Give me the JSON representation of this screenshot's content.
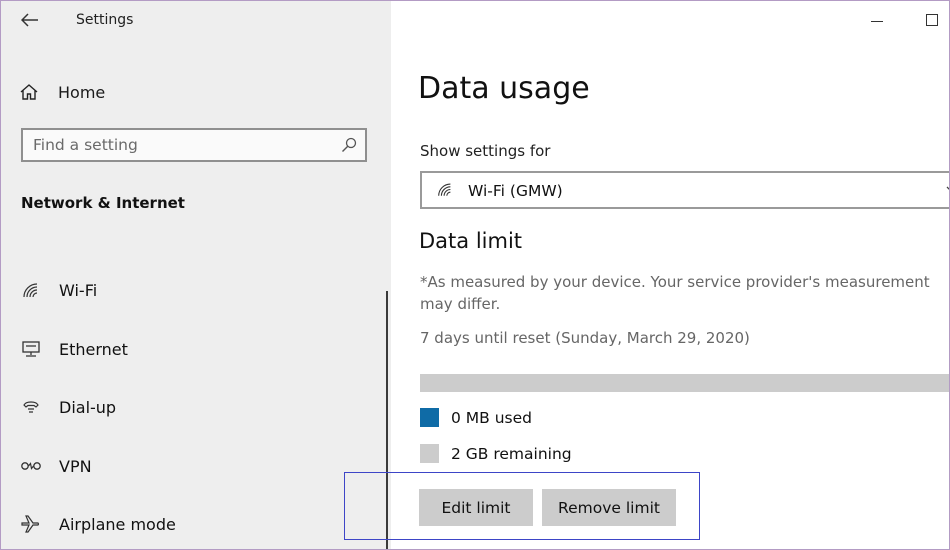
{
  "window": {
    "title": "Settings",
    "controls": {
      "minimize": "minimize",
      "maximize": "maximize"
    }
  },
  "sidebar": {
    "home_label": "Home",
    "search": {
      "placeholder": "Find a setting",
      "value": ""
    },
    "section_title": "Network & Internet",
    "items": [
      {
        "label": "Wi-Fi",
        "icon": "wifi-icon"
      },
      {
        "label": "Ethernet",
        "icon": "ethernet-icon"
      },
      {
        "label": "Dial-up",
        "icon": "dialup-icon"
      },
      {
        "label": "VPN",
        "icon": "vpn-icon"
      },
      {
        "label": "Airplane mode",
        "icon": "airplane-icon"
      }
    ]
  },
  "main": {
    "title": "Data usage",
    "show_settings_label": "Show settings for",
    "network_selected": "Wi-Fi (GMW)",
    "data_limit_heading": "Data limit",
    "note": "*As measured by your device. Your service provider's measurement may differ.",
    "reset_text": "7 days until reset (Sunday, March 29, 2020)",
    "usage_fraction": 0,
    "used_label": "0 MB used",
    "remaining_label": "2 GB remaining",
    "edit_button": "Edit limit",
    "remove_button": "Remove limit"
  },
  "colors": {
    "sidebar_bg": "#eeeeee",
    "used": "#0f6ba6",
    "remaining": "#cccccc",
    "highlight_box": "#3d45c7"
  }
}
